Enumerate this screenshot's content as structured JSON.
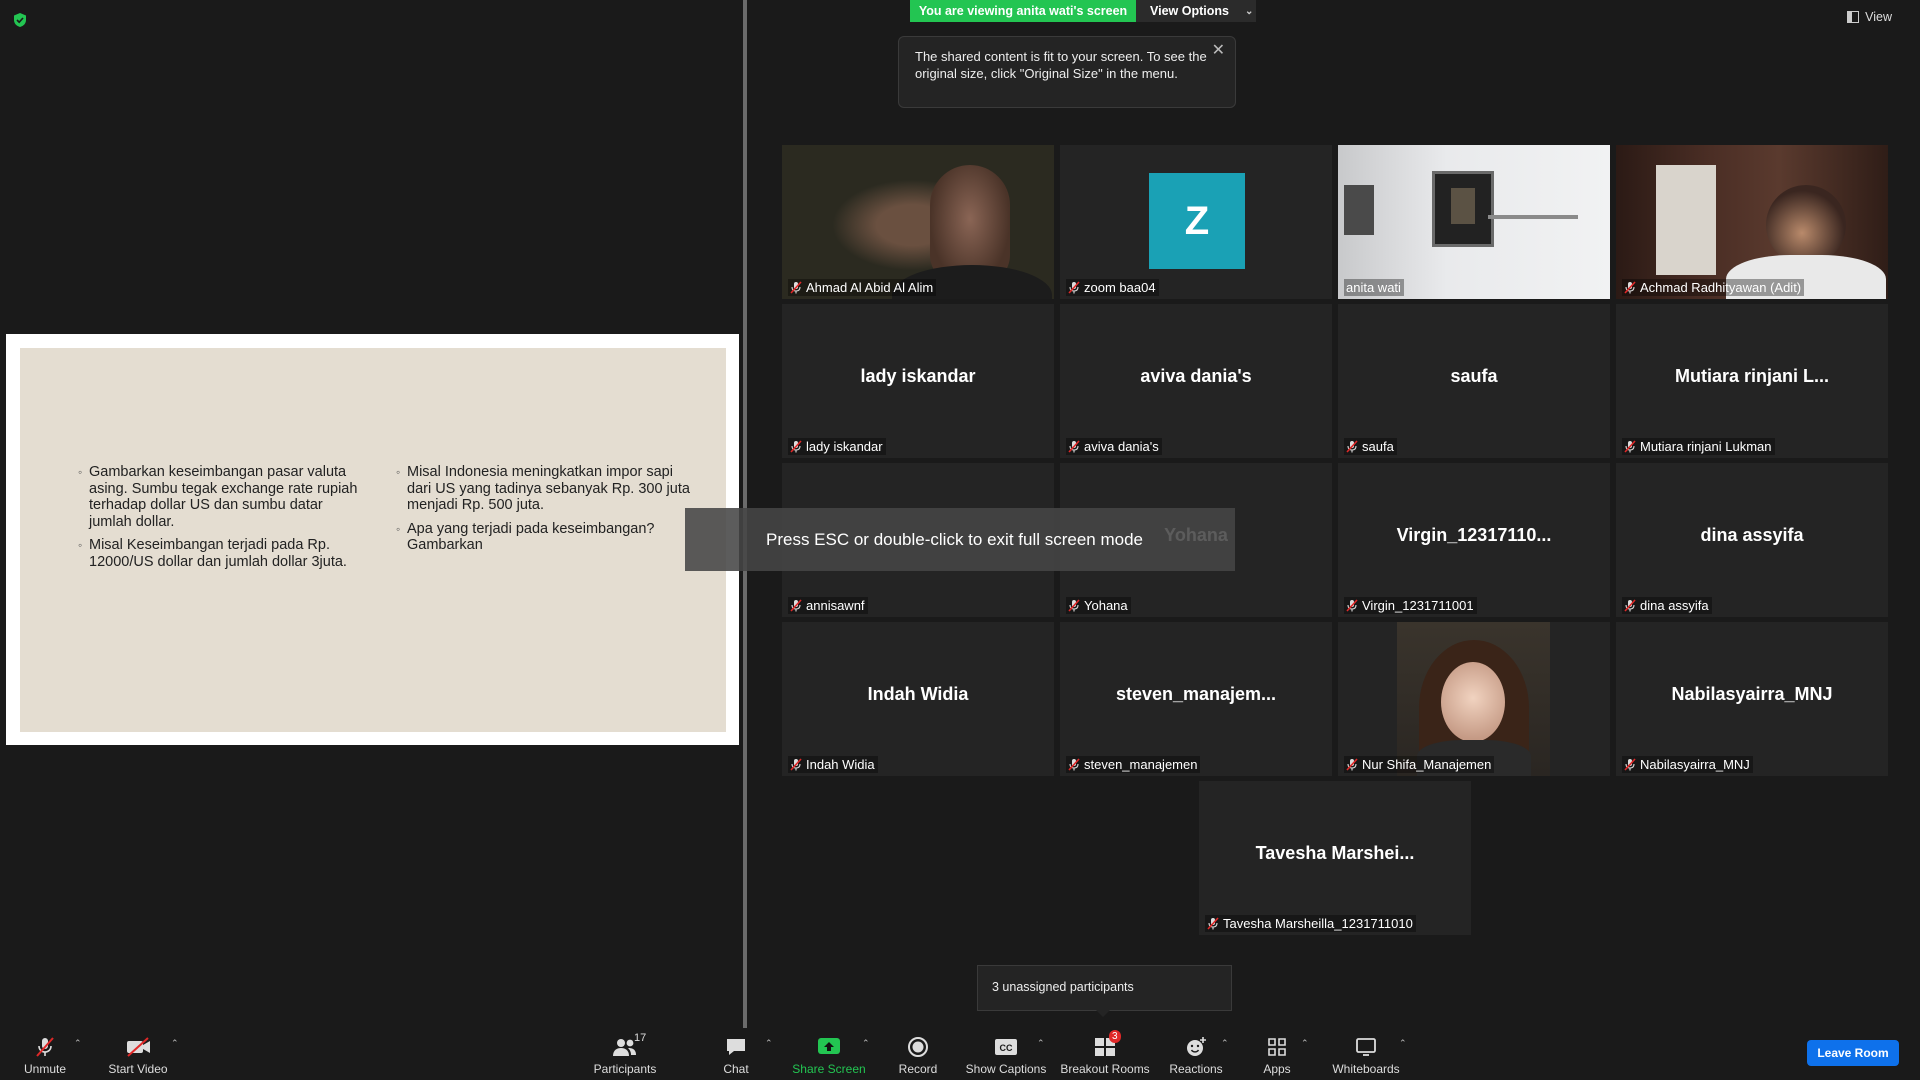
{
  "banner": {
    "viewing": "You are viewing anita wati's screen",
    "view_options": "View Options"
  },
  "view_button": "View",
  "tooltip": "The shared content is fit to your screen. To see the original size, click \"Original Size\" in the menu.",
  "slide": {
    "col1": [
      "Gambarkan keseimbangan pasar valuta asing. Sumbu tegak exchange rate rupiah terhadap dollar US dan sumbu datar jumlah dollar.",
      "Misal Keseimbangan terjadi pada Rp. 12000/US dollar dan jumlah dollar 3juta."
    ],
    "col2": [
      "Misal Indonesia meningkatkan impor sapi dari US yang tadinya sebanyak Rp. 300 juta menjadi Rp. 500 juta.",
      "Apa yang terjadi pada keseimbangan? Gambarkan"
    ]
  },
  "participants": [
    {
      "label": "Ahmad Al Abid Al Alim",
      "big": "",
      "muted": true
    },
    {
      "label": "zoom baa04",
      "big": "",
      "avatar": "Z",
      "muted": true
    },
    {
      "label": "anita wati",
      "big": "",
      "muted": false,
      "active": true
    },
    {
      "label": "Achmad Radhityawan (Adit)",
      "big": "",
      "muted": true
    },
    {
      "label": "lady iskandar",
      "big": "lady iskandar",
      "muted": true
    },
    {
      "label": "aviva dania's",
      "big": "aviva dania's",
      "muted": true
    },
    {
      "label": "saufa",
      "big": "saufa",
      "muted": true
    },
    {
      "label": "Mutiara rinjani Lukman",
      "big": "Mutiara rinjani L...",
      "muted": true
    },
    {
      "label": "annisawnf",
      "big": "",
      "muted": true
    },
    {
      "label": "Yohana",
      "big": "Yohana",
      "muted": true
    },
    {
      "label": "Virgin_1231711001",
      "big": "Virgin_12317110...",
      "muted": true
    },
    {
      "label": "dina assyifa",
      "big": "dina assyifa",
      "muted": true
    },
    {
      "label": "Indah Widia",
      "big": "Indah Widia",
      "muted": true
    },
    {
      "label": "steven_manajemen",
      "big": "steven_manajem...",
      "muted": true
    },
    {
      "label": "Nur Shifa_Manajemen",
      "big": "",
      "muted": true
    },
    {
      "label": "Nabilasyairra_MNJ",
      "big": "Nabilasyairra_MNJ",
      "muted": true
    },
    {
      "label": "Tavesha Marsheilla_1231711010",
      "big": "Tavesha Marshei...",
      "muted": true
    }
  ],
  "esc_notice": "Press ESC or double-click to exit full screen mode",
  "unassigned": "3 unassigned participants",
  "toolbar": {
    "unmute": "Unmute",
    "start_video": "Start Video",
    "participants": "Participants",
    "participants_count": "17",
    "chat": "Chat",
    "share_screen": "Share Screen",
    "record": "Record",
    "show_captions": "Show Captions",
    "breakout_rooms": "Breakout Rooms",
    "breakout_badge": "3",
    "reactions": "Reactions",
    "apps": "Apps",
    "whiteboards": "Whiteboards",
    "leave_room": "Leave Room"
  },
  "colors": {
    "accent_green": "#23c552",
    "active_speaker": "#e9e57a",
    "leave_blue": "#0e71eb",
    "mute_red": "#e02828"
  }
}
